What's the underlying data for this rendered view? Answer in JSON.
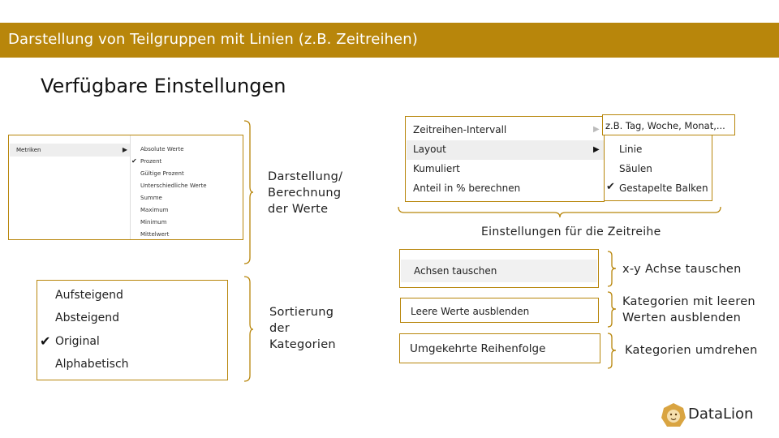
{
  "title": "Darstellung von Teilgruppen mit Linien (z.B. Zeitreihen)",
  "heading": "Verfügbare Einstellungen",
  "metrics_menu": {
    "item": "Metriken",
    "options": [
      "Absolute Werte",
      "Prozent",
      "Gültige Prozent",
      "Unterschiedliche Werte",
      "Summe",
      "Maximum",
      "Minimum",
      "Mittelwert"
    ],
    "checked": "Prozent",
    "caption": [
      "Darstellung/",
      "Berechnung",
      "der Werte"
    ]
  },
  "sort_menu": {
    "options": [
      "Aufsteigend",
      "Absteigend",
      "Original",
      "Alphabetisch"
    ],
    "checked": "Original",
    "caption": [
      "Sortierung",
      "der",
      "Kategorien"
    ]
  },
  "timeseries_menu": {
    "items": [
      "Zeitreihen-Intervall",
      "Layout",
      "Kumuliert",
      "Anteil in % berechnen"
    ],
    "interval_hint": "z.B. Tag, Woche, Monat,...",
    "layout_options": [
      "Linie",
      "Säulen",
      "Gestapelte Balken"
    ],
    "checked": "Gestapelte Balken",
    "caption": "Einstellungen für die Zeitreihe"
  },
  "toggles": [
    {
      "label": "Achsen tauschen",
      "caption": "x-y Achse tauschen"
    },
    {
      "label": "Leere Werte ausblenden",
      "caption_lines": [
        "Kategorien mit leeren",
        "Werten ausblenden"
      ]
    },
    {
      "label": "Umgekehrte Reihenfolge",
      "caption": "Kategorien umdrehen"
    }
  ],
  "logo": {
    "name": "DataLion",
    "icon": "lion-icon"
  },
  "colors": {
    "accent": "#b8860b",
    "highlight": "#eeeeee"
  }
}
